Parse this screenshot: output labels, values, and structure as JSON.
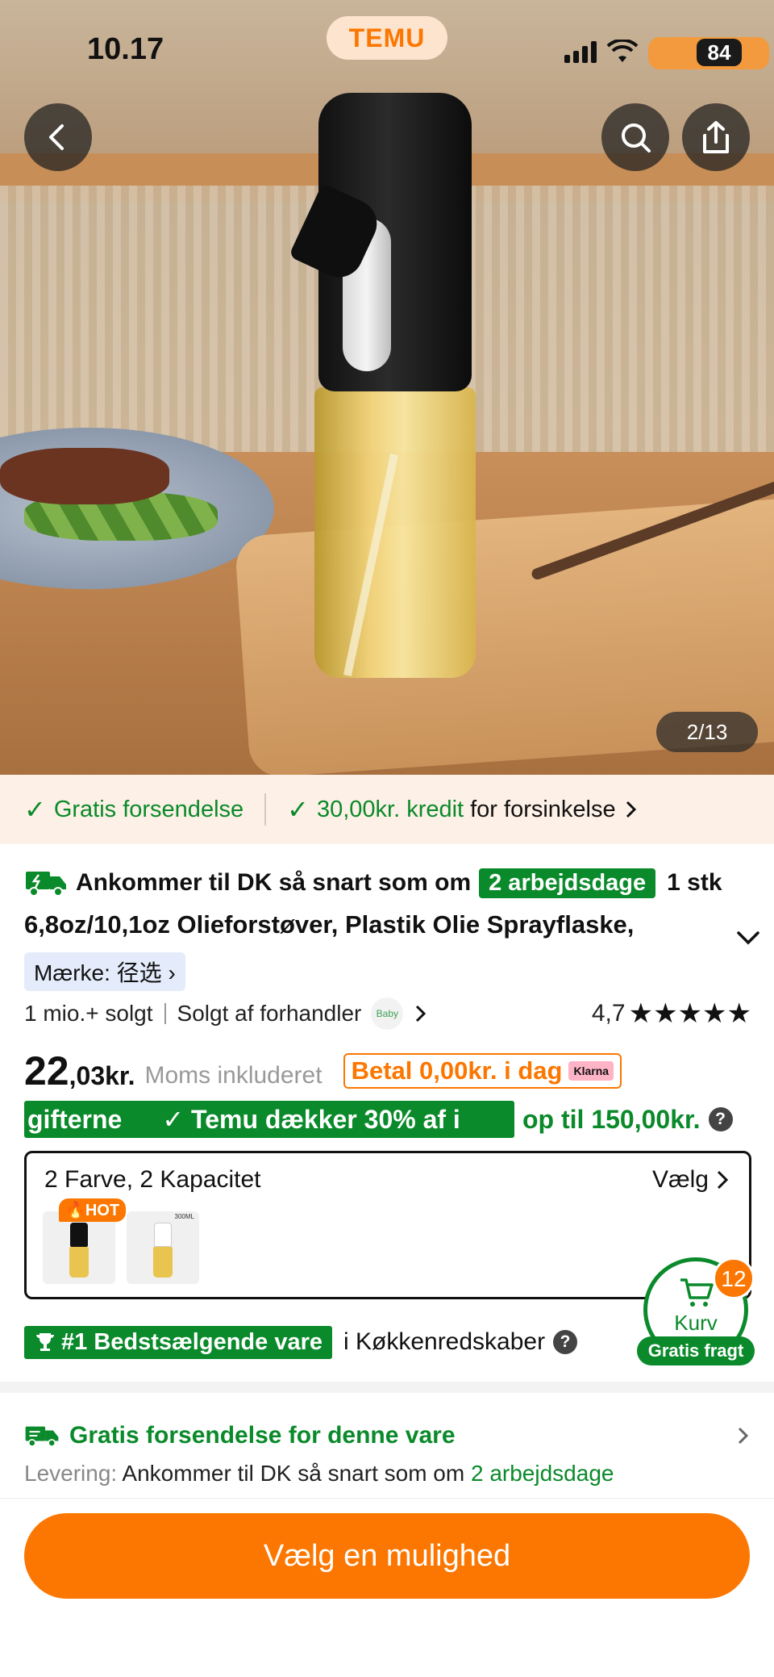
{
  "status": {
    "time": "10.17",
    "battery": "84"
  },
  "app": {
    "logo": "TEMU"
  },
  "gallery": {
    "counter": "2/13"
  },
  "promo": {
    "free_shipping": "Gratis forsendelse",
    "credit_amount": "30,00kr. kredit",
    "credit_suffix": "for forsinkelse"
  },
  "product": {
    "arrival_prefix": "Ankommer til DK så snart som om",
    "arrival_days": "2 arbejdsdage",
    "title_start": "1 stk",
    "title_line2": "6,8oz/10,1oz Olieforstøver, Plastik Olie Sprayflaske,",
    "brand": "Mærke: 径选",
    "sold": "1 mio.+ solgt",
    "seller": "Solgt af forhandler",
    "seller_badge": "Baby",
    "rating": "4,7",
    "stars": "★★★★★",
    "price_int": "22",
    "price_dec": ",03kr.",
    "vat": "Moms inkluderet",
    "klarna_text": "Betal 0,00kr. i dag",
    "klarna_brand": "Klarna",
    "subsidy_a": "gifterne",
    "subsidy_b": "✓ Temu dækker 30% af i",
    "subsidy_tail": "op til 150,00kr.",
    "help": "?"
  },
  "variants": {
    "summary": "2 Farve, 2 Kapacitet",
    "choose": "Vælg",
    "hot": "HOT",
    "thumb2_label": "300ML"
  },
  "cart": {
    "count": "12",
    "label": "Kurv",
    "free": "Gratis fragt"
  },
  "bestseller": {
    "badge": "#1 Bedstsælgende vare",
    "category": "i Køkkenredskaber"
  },
  "shipping": {
    "title": "Gratis forsendelse for denne vare",
    "delivery_label": "Levering:",
    "delivery_text": "Ankommer til DK så snart som om",
    "delivery_days": "2 arbejdsdage"
  },
  "cta": {
    "label": "Vælg en mulighed"
  },
  "colors": {
    "accent": "#fb7701",
    "green": "#0a8a2a"
  }
}
